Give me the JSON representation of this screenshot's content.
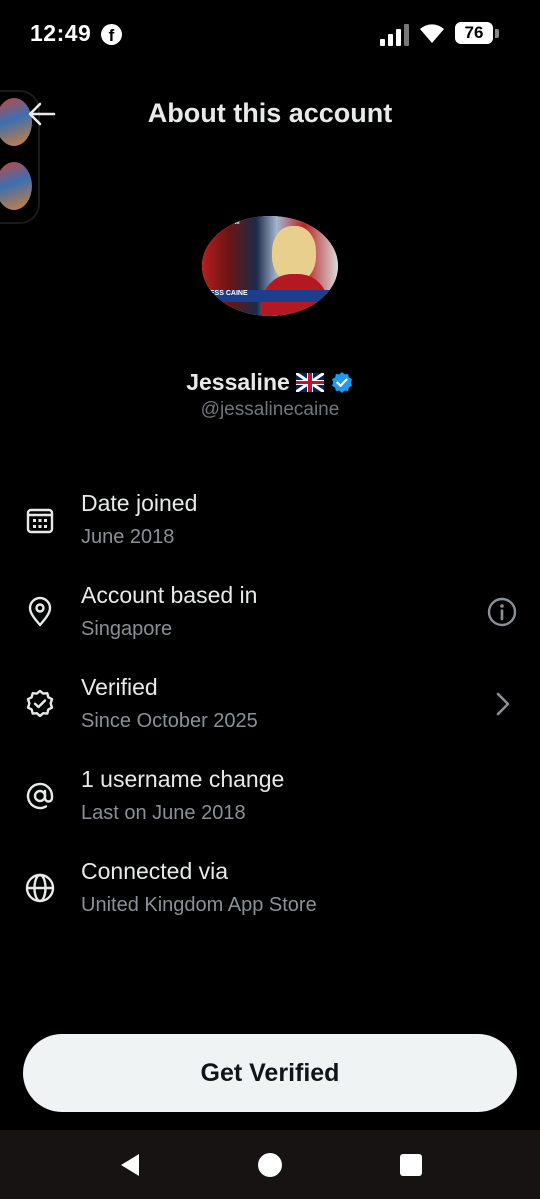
{
  "status_bar": {
    "time": "12:49",
    "battery": "76"
  },
  "header": {
    "title": "About this account"
  },
  "profile": {
    "display_name": "Jessaline",
    "handle": "@jessalinecaine",
    "avatar_lower_text": "JESS CAINE",
    "avatar_top_text": "S.COM"
  },
  "rows": [
    {
      "icon": "calendar-icon",
      "title": "Date joined",
      "subtitle": "June 2018"
    },
    {
      "icon": "location-pin-icon",
      "title": "Account based in",
      "subtitle": "Singapore"
    },
    {
      "icon": "verified-badge-icon",
      "title": "Verified",
      "subtitle": "Since October 2025"
    },
    {
      "icon": "at-sign-icon",
      "title": "1 username change",
      "subtitle": "Last on June 2018"
    },
    {
      "icon": "globe-icon",
      "title": "Connected via",
      "subtitle": "United Kingdom App Store"
    }
  ],
  "cta": {
    "label": "Get Verified"
  },
  "colors": {
    "background": "#000000",
    "verified_blue": "#1d9bf0",
    "cta_bg": "#eff3f4"
  }
}
